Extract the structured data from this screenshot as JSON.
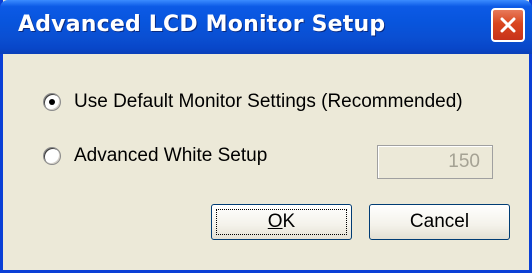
{
  "window": {
    "title": "Advanced LCD Monitor Setup",
    "close_icon": "close-icon"
  },
  "options": [
    {
      "label": "Use Default Monitor Settings (Recommended)",
      "selected": true
    },
    {
      "label": "Advanced White Setup",
      "selected": false
    }
  ],
  "white_setup": {
    "value": "150",
    "enabled": false
  },
  "buttons": {
    "ok_first": "O",
    "ok_rest": "K",
    "cancel": "Cancel"
  },
  "colors": {
    "title_bar": "#0a4fd2",
    "dialog_bg": "#ece9d8",
    "close_button": "#d9461f",
    "disabled_text": "#a5a294"
  }
}
